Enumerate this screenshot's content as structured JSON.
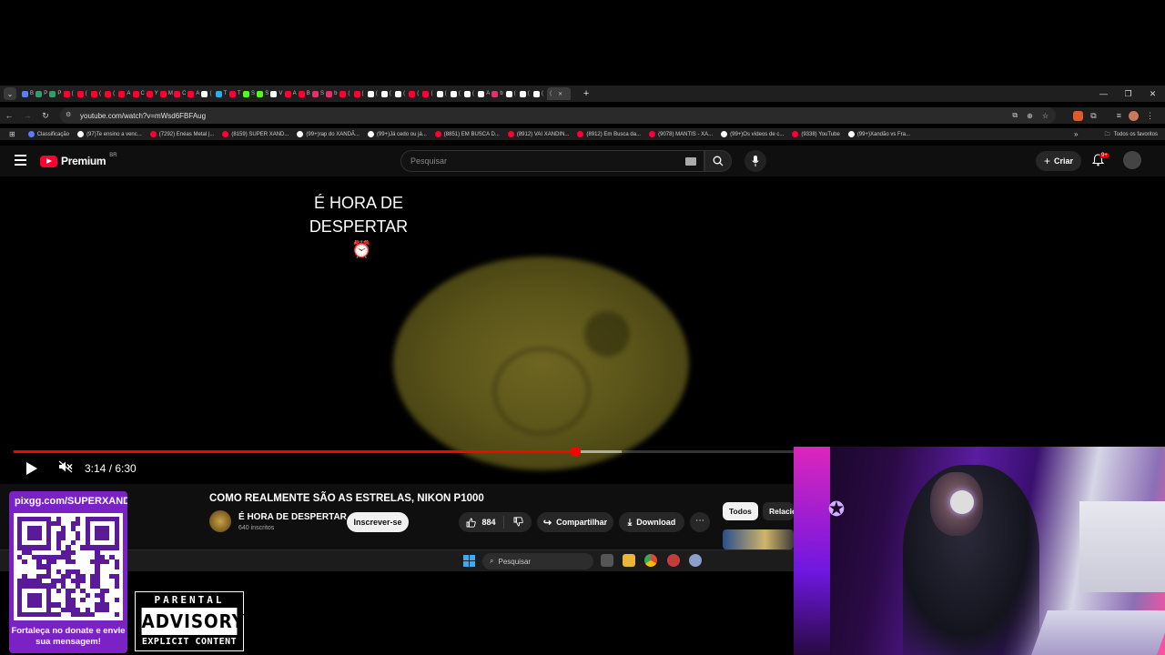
{
  "browser": {
    "url": "youtube.com/watch?v=mWsd6FBFAug",
    "tabs": [
      {
        "letter": "B",
        "color": "#5b7cff"
      },
      {
        "letter": "P",
        "color": "#2e9e6a"
      },
      {
        "letter": "P",
        "color": "#2e9e6a"
      },
      {
        "letter": "(",
        "color": "#ff0033"
      },
      {
        "letter": "(",
        "color": "#ff0033"
      },
      {
        "letter": "(",
        "color": "#ff0033"
      },
      {
        "letter": "(",
        "color": "#ff0033"
      },
      {
        "letter": "A",
        "color": "#ff0033"
      },
      {
        "letter": "C",
        "color": "#ff0033"
      },
      {
        "letter": "Y",
        "color": "#ff0033"
      },
      {
        "letter": "M",
        "color": "#ff0033"
      },
      {
        "letter": "C",
        "color": "#ff0033"
      },
      {
        "letter": "A",
        "color": "#ff0033"
      },
      {
        "letter": "(",
        "color": "#ffffff"
      },
      {
        "letter": "T",
        "color": "#2aabee"
      },
      {
        "letter": "T",
        "color": "#ff0033"
      },
      {
        "letter": "S",
        "color": "#53fc18"
      },
      {
        "letter": "S",
        "color": "#53fc18"
      },
      {
        "letter": "V",
        "color": "#ffffff"
      },
      {
        "letter": "A",
        "color": "#ff0033"
      },
      {
        "letter": "B",
        "color": "#ff0033"
      },
      {
        "letter": "S",
        "color": "#e1306c"
      },
      {
        "letter": "b",
        "color": "#e1306c"
      },
      {
        "letter": "(",
        "color": "#ff0033"
      },
      {
        "letter": "(",
        "color": "#ff0033"
      },
      {
        "letter": "(",
        "color": "#ffffff"
      },
      {
        "letter": "(",
        "color": "#ffffff"
      },
      {
        "letter": "(",
        "color": "#ffffff"
      },
      {
        "letter": "(",
        "color": "#ff0033"
      },
      {
        "letter": "(",
        "color": "#ff0033"
      },
      {
        "letter": "(",
        "color": "#ffffff"
      },
      {
        "letter": "(",
        "color": "#ffffff"
      },
      {
        "letter": "(",
        "color": "#ffffff"
      },
      {
        "letter": "A",
        "color": "#ffffff"
      },
      {
        "letter": "b",
        "color": "#e1306c"
      },
      {
        "letter": "(",
        "color": "#ffffff"
      },
      {
        "letter": "(",
        "color": "#ffffff"
      },
      {
        "letter": "(",
        "color": "#ffffff"
      }
    ],
    "active_tab_letter": "(",
    "bookmarks": [
      {
        "label": "Classificação",
        "color": "#5b7cff"
      },
      {
        "label": "(97)Te ensino a venc...",
        "color": "#ffffff"
      },
      {
        "label": "(7292) Enéas Metal |...",
        "color": "#ff0033"
      },
      {
        "label": "(8159) SUPER XAND...",
        "color": "#ff0033"
      },
      {
        "label": "(99+)rap do XANDÃ...",
        "color": "#ffffff"
      },
      {
        "label": "(99+)Já cedo ou já...",
        "color": "#ffffff"
      },
      {
        "label": "(8851) EM BUSCA D...",
        "color": "#ff0033"
      },
      {
        "label": "(8912) VAI XANDIN...",
        "color": "#ff0033"
      },
      {
        "label": "(8912) Em Busca da...",
        "color": "#ff0033"
      },
      {
        "label": "(9078) MANTIS - XA...",
        "color": "#ff0033"
      },
      {
        "label": "(99+)Os vídeos de c...",
        "color": "#ffffff"
      },
      {
        "label": "(9338) YouTube",
        "color": "#ff0033"
      },
      {
        "label": "(99+)Xandão vs Fra...",
        "color": "#ffffff"
      }
    ],
    "all_bookmarks_label": "Todos os favoritos"
  },
  "youtube": {
    "brand": "Premium",
    "region": "BR",
    "search_placeholder": "Pesquisar",
    "create_label": "Criar",
    "notif_count": "9+"
  },
  "video": {
    "overlay_text": "É HORA DE DESPERTAR",
    "alarm_icon": "⏰",
    "time_display": "3:14 / 6:30",
    "progress_fraction": 0.72,
    "buffer_fraction": 0.78
  },
  "meta": {
    "title": "COMO REALMENTE SÃO AS ESTRELAS, NIKON P1000",
    "channel": "É HORA DE DESPERTAR",
    "subscribers": "640 inscritos",
    "subscribe_label": "Inscrever-se",
    "likes": "884",
    "share_label": "Compartilhar",
    "download_label": "Download",
    "chip_all": "Todos",
    "chip_related": "Relacion"
  },
  "taskbar": {
    "search_label": "Pesquisar"
  },
  "overlay": {
    "donate_url": "pixgg.com/SUPERXANDA",
    "donate_text": "Fortaleça no donate e envie sua mensagem!",
    "advisory_top": "PARENTAL",
    "advisory_mid": "ADVISORY",
    "advisory_bottom": "EXPLICIT CONTENT"
  },
  "colors": {
    "yt_red": "#ff0033",
    "donate_purple": "#7b22c7"
  }
}
